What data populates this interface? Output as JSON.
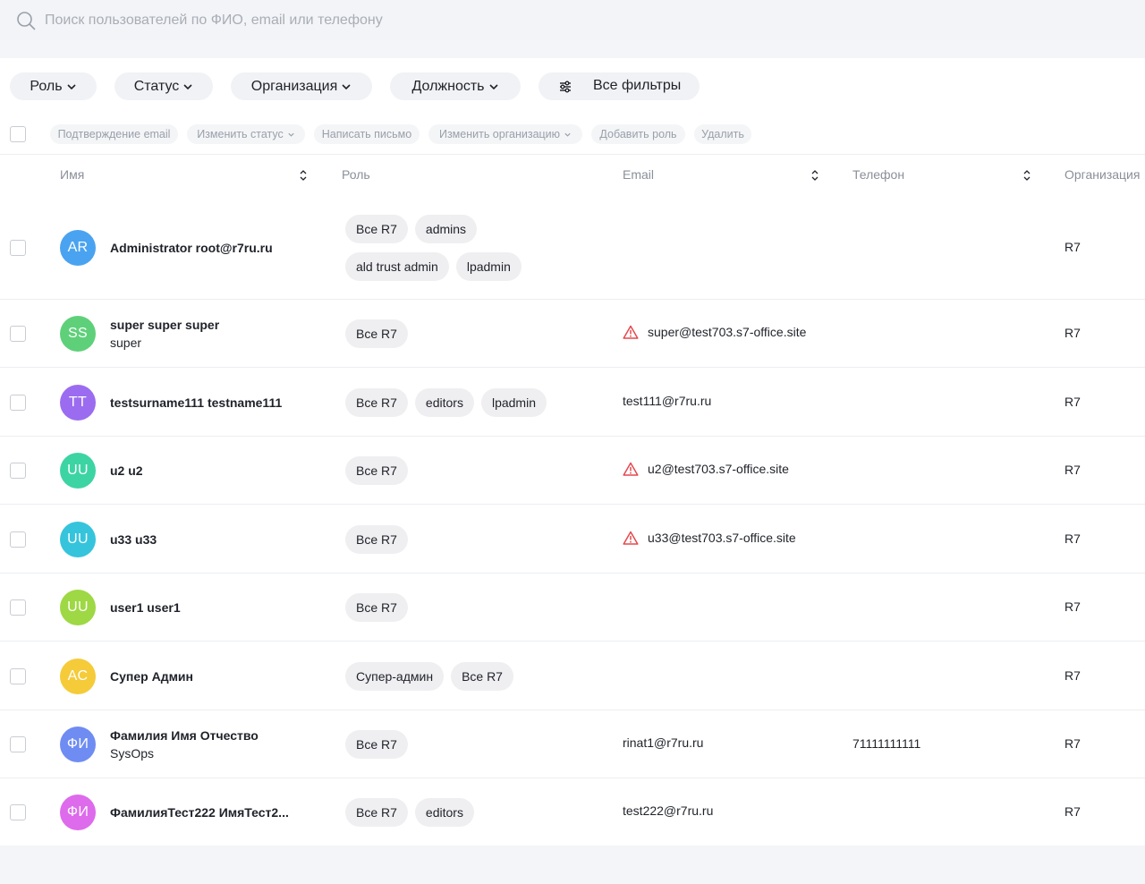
{
  "search": {
    "placeholder": "Поиск пользователей по ФИО, email или телефону"
  },
  "filters": {
    "role": "Роль",
    "status": "Статус",
    "organization": "Организация",
    "position": "Должность",
    "all": "Все фильтры"
  },
  "actions": {
    "confirm_email": "Подтверждение email",
    "change_status": "Изменить статус",
    "write_letter": "Написать письмо",
    "change_org": "Изменить организацию",
    "add_role": "Добавить роль",
    "delete": "Удалить"
  },
  "columns": {
    "name": "Имя",
    "role": "Роль",
    "email": "Email",
    "phone": "Телефон",
    "organization": "Организация"
  },
  "colors": {
    "warning": "#e5484d",
    "avatar_blue": "#4aa3f0",
    "avatar_green": "#5fd07a",
    "avatar_purple": "#9b6cf0",
    "avatar_teal": "#3dd4a4",
    "avatar_cyan": "#35c4dc",
    "avatar_lime": "#9ed844",
    "avatar_yellow": "#f5cb3a",
    "avatar_periwinkle": "#6f8cf2",
    "avatar_pink": "#dd6bec"
  },
  "users": [
    {
      "initials": "AR",
      "avatar_color": "#4aa3f0",
      "name": "Administrator root@r7ru.ru",
      "subname": "",
      "roles": [
        "Все R7",
        "admins",
        "ald trust admin",
        "lpadmin"
      ],
      "email": "",
      "email_warning": false,
      "phone": "",
      "org": "R7"
    },
    {
      "initials": "SS",
      "avatar_color": "#5fd07a",
      "name": "super super super",
      "subname": "super",
      "roles": [
        "Все R7"
      ],
      "email": "super@test703.s7-office.site",
      "email_warning": true,
      "phone": "",
      "org": "R7"
    },
    {
      "initials": "TT",
      "avatar_color": "#9b6cf0",
      "name": "testsurname111 testname111",
      "subname": "",
      "roles": [
        "Все R7",
        "editors",
        "lpadmin"
      ],
      "email": "test111@r7ru.ru",
      "email_warning": false,
      "phone": "",
      "org": "R7"
    },
    {
      "initials": "UU",
      "avatar_color": "#3dd4a4",
      "name": "u2 u2",
      "subname": "",
      "roles": [
        "Все R7"
      ],
      "email": "u2@test703.s7-office.site",
      "email_warning": true,
      "phone": "",
      "org": "R7"
    },
    {
      "initials": "UU",
      "avatar_color": "#35c4dc",
      "name": "u33 u33",
      "subname": "",
      "roles": [
        "Все R7"
      ],
      "email": "u33@test703.s7-office.site",
      "email_warning": true,
      "phone": "",
      "org": "R7"
    },
    {
      "initials": "UU",
      "avatar_color": "#9ed844",
      "name": "user1 user1",
      "subname": "",
      "roles": [
        "Все R7"
      ],
      "email": "",
      "email_warning": false,
      "phone": "",
      "org": "R7"
    },
    {
      "initials": "AC",
      "avatar_color": "#f5cb3a",
      "name": "Супер Админ",
      "subname": "",
      "roles": [
        "Супер-админ",
        "Все R7"
      ],
      "email": "",
      "email_warning": false,
      "phone": "",
      "org": "R7"
    },
    {
      "initials": "ФИ",
      "avatar_color": "#6f8cf2",
      "name": "Фамилия Имя Отчество",
      "subname": "SysOps",
      "roles": [
        "Все R7"
      ],
      "email": "rinat1@r7ru.ru",
      "email_warning": false,
      "phone": "71111111111",
      "org": "R7"
    },
    {
      "initials": "ФИ",
      "avatar_color": "#dd6bec",
      "name": "ФамилияТест222 ИмяТест2...",
      "subname": "",
      "roles": [
        "Все R7",
        "editors"
      ],
      "email": "test222@r7ru.ru",
      "email_warning": false,
      "phone": "",
      "org": "R7"
    }
  ]
}
